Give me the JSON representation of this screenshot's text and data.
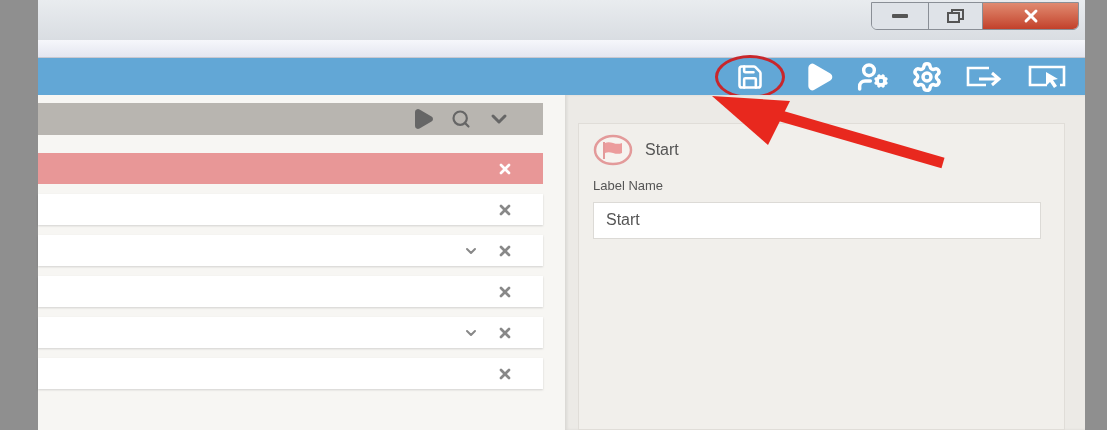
{
  "toolbar": [
    {
      "kind": "save",
      "highlighted": true
    },
    {
      "kind": "play",
      "highlighted": false
    },
    {
      "kind": "user-settings",
      "highlighted": false
    },
    {
      "kind": "settings",
      "highlighted": false
    },
    {
      "kind": "export",
      "highlighted": false
    },
    {
      "kind": "select",
      "highlighted": false
    }
  ],
  "rows": [
    {
      "selected": true,
      "expandable": false
    },
    {
      "selected": false,
      "expandable": false
    },
    {
      "selected": false,
      "expandable": true
    },
    {
      "selected": false,
      "expandable": false
    },
    {
      "selected": false,
      "expandable": true
    },
    {
      "selected": false,
      "expandable": false
    }
  ],
  "properties": {
    "node_title": "Start",
    "field_label": "Label Name",
    "field_value": "Start"
  }
}
